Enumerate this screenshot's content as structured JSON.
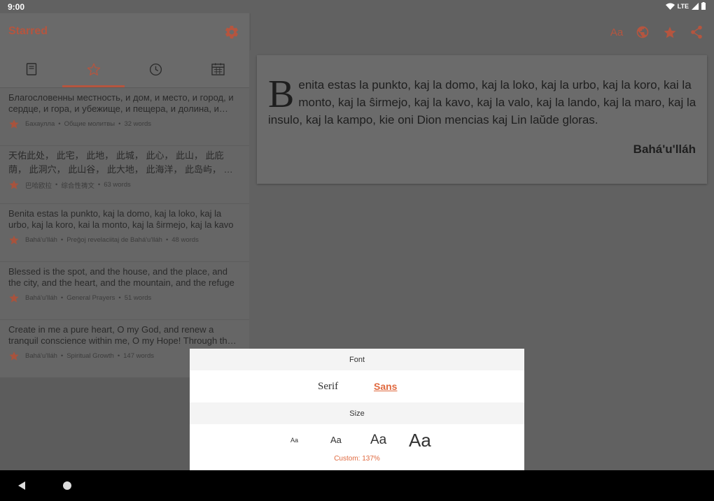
{
  "status_bar": {
    "time": "9:00",
    "network": "LTE"
  },
  "left_pane": {
    "title": "Starred",
    "tabs": [
      {
        "icon": "book-icon"
      },
      {
        "icon": "star-outline-icon",
        "selected": true
      },
      {
        "icon": "clock-icon"
      },
      {
        "icon": "calendar-icon"
      }
    ],
    "items": [
      {
        "text": "Благословенны местность, и дом, и место, и город, и сердце, и гора, и убежище, и пещера, и долина, и земля, и море",
        "author": "Бахаулла",
        "category": "Общие молитвы",
        "words": "32 words"
      },
      {
        "text": "天佑此处， 此宅， 此地， 此城， 此心， 此山， 此庇荫， 此洞穴， 此山谷， 此大地， 此海洋， 此岛屿， 此草原",
        "author": "巴哈欧拉",
        "category": "综合性祷文",
        "words": "63 words"
      },
      {
        "text": "Benita estas la punkto, kaj la domo, kaj la loko, kaj la urbo, kaj la koro, kai la monto, kaj la ŝirmejo, kaj la kavo",
        "author": "Bahá'u'lláh",
        "category": "Preĝoj revelaciitaj de Bahá'u'lláh",
        "words": "48 words"
      },
      {
        "text": "Blessed is the spot, and the house, and the place, and the city, and the heart, and the mountain, and the refuge",
        "author": "Bahá'u'lláh",
        "category": "General Prayers",
        "words": "51 words"
      },
      {
        "text": "Create in me a pure heart, O my God, and renew a tranquil conscience within me, O my Hope! Through the spirit of power",
        "author": "Bahá'u'lláh",
        "category": "Spiritual Growth",
        "words": "147 words"
      }
    ]
  },
  "right_pane": {
    "actions": {
      "font_label": "Aa"
    },
    "card": {
      "dropcap": "B",
      "text": "enita estas la punkto, kaj la domo, kaj la loko, kaj la urbo, kaj la koro, kai la monto, kaj la ŝirmejo, kaj la kavo, kaj la valo, kaj la lando, kaj la maro, kaj la insulo, kaj la kampo, kie oni Dion mencias kaj Lin laŭde gloras.",
      "author": "Bahá'u'lláh"
    }
  },
  "font_sheet": {
    "font_header": "Font",
    "font_options": [
      "Serif",
      "Sans"
    ],
    "selected_font": "Sans",
    "size_header": "Size",
    "size_sample": "Aa",
    "custom_label": "Custom: 137%"
  },
  "colors": {
    "accent": "#b5553f",
    "highlight": "#e0693f"
  }
}
